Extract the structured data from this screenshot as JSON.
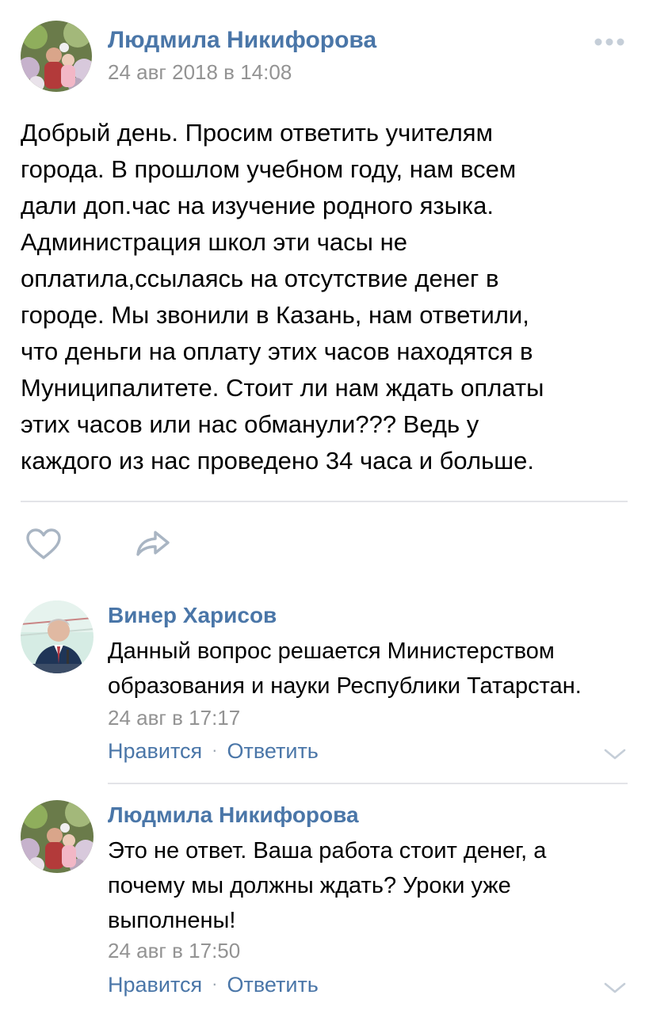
{
  "post": {
    "author": "Людмила Никифорова",
    "date": "24 авг 2018 в 14:08",
    "text_lines": [
      "Добрый день. Просим ответить учителям",
      "города. В прошлом учебном году, нам всем",
      "дали доп.час на изучение родного языка.",
      "Администрация школ эти часы не",
      "оплатила,ссылаясь на отсутствие денег в",
      "городе. Мы звонили в Казань, нам ответили,",
      "что деньги на оплату этих часов находятся в",
      "Муниципалитете. Стоит ли нам ждать оплаты",
      "этих часов или нас обманули??? Ведь у",
      "каждого из нас проведено 34 часа и больше."
    ],
    "icons": {
      "more": "more-dots-icon",
      "like": "heart-icon",
      "share": "share-arrow-icon"
    }
  },
  "comments": [
    {
      "author": "Винер Харисов",
      "text_lines": [
        "Данный вопрос решается Министерством",
        "образования и науки Республики Татарстан."
      ],
      "date": "24 авг в 17:17",
      "like_label": "Нравится",
      "reply_label": "Ответить"
    },
    {
      "author": "Людмила Никифорова",
      "text_lines": [
        "Это не ответ. Ваша работа стоит денег, а",
        "почему мы должны ждать? Уроки уже",
        "выполнены!"
      ],
      "date": "24 авг в 17:50",
      "like_label": "Нравится",
      "reply_label": "Ответить"
    }
  ],
  "colors": {
    "link": "#4a76a8",
    "secondary_text": "#939393",
    "icon": "#a9b5c3",
    "divider": "#e3e4e8"
  }
}
